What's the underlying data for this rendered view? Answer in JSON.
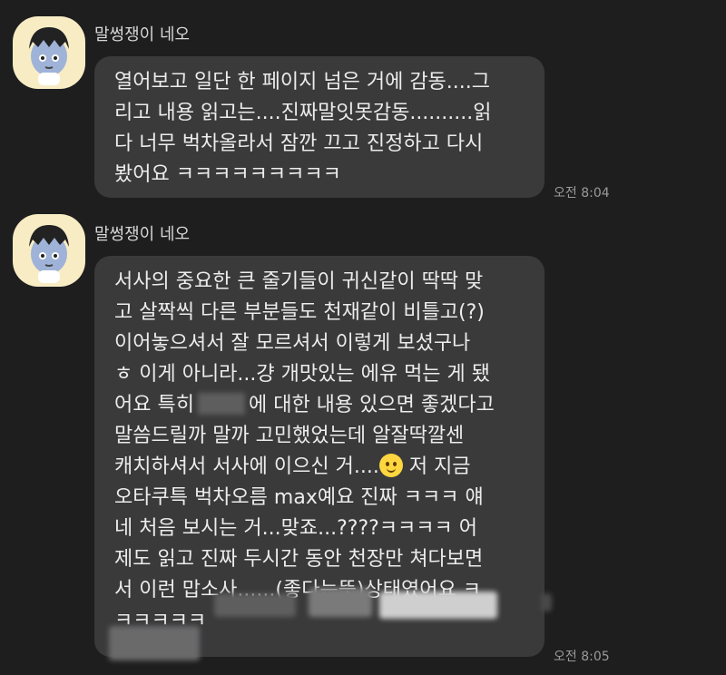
{
  "messages": [
    {
      "sender": "말썽쟁이 네오",
      "lines": [
        "열어보고 일단 한 페이지 넘은 거에 감동....그",
        "리고 내용 읽고는....진짜말잇못감동..........읽",
        "다 너무 벅차올라서 잠깐 끄고 진정하고 다시",
        "봤어요 ㅋㅋㅋㅋㅋㅋㅋㅋㅋ"
      ],
      "time": "오전 8:04"
    },
    {
      "sender": "말썽쟁이 네오",
      "lines": [
        "서사의 중요한 큰 줄기들이 귀신같이 딱딱 맞",
        "고 살짝씩 다른 부분들도 천재같이 비틀고(?)",
        "이어놓으셔서 잘 모르셔서 이렇게 보셨구나",
        "ㅎ 이게 아니라...걍 개맛있는 에유 먹는 게 됐"
      ],
      "line5a": "어요 특히",
      "line5b": "에 대한 내용 있으면 좋겠다고",
      "line6": "말씀드릴까 말까 고민했었는데 알잘딱깔센",
      "line7": "캐치하셔서 서사에 이으신 거....",
      "line7b": " 저 지금",
      "lines_after": [
        "오타쿠특 벅차오름 max예요 진짜 ㅋㅋㅋ 얘",
        "네 처음 보시는 거...맞죠...????ㅋㅋㅋㅋ 어",
        "제도 읽고 진짜 두시간 동안 천장만 쳐다보면",
        "서 이런 맙소사......(좋다는뜻)상태였어요 ㅋ"
      ],
      "line12": "ㅋㅋㅋㅋㅋ",
      "time": "오전 8:05"
    }
  ],
  "colors": {
    "background": "#1e1e1f",
    "bubble": "#3a3a3b",
    "avatar_bg": "#f7ecc4"
  }
}
